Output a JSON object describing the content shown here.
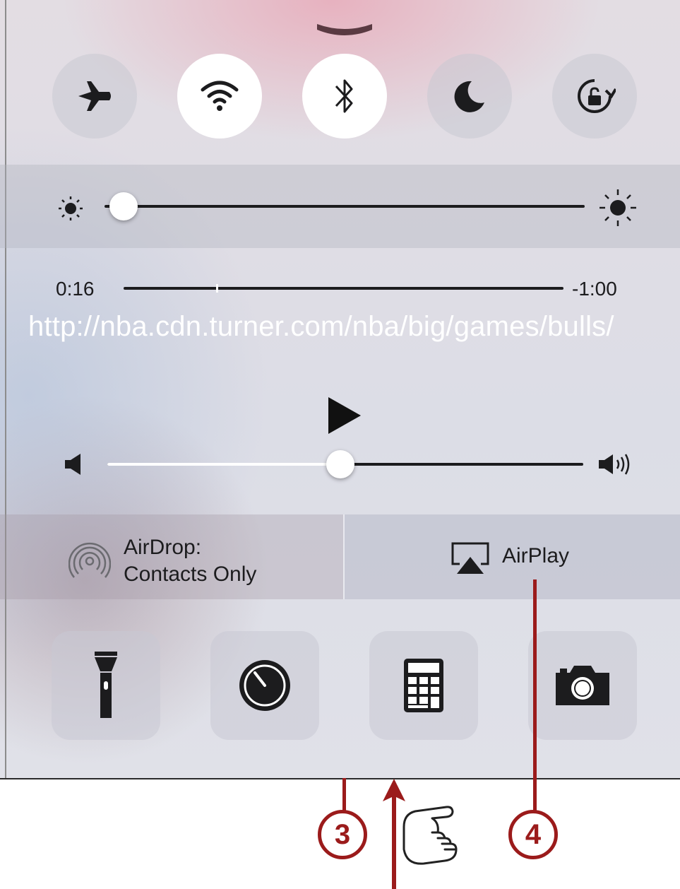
{
  "toggles": [
    {
      "icon": "airplane-icon",
      "state": "off"
    },
    {
      "icon": "wifi-icon",
      "state": "on"
    },
    {
      "icon": "bluetooth-icon",
      "state": "on"
    },
    {
      "icon": "moon-icon",
      "state": "off"
    },
    {
      "icon": "rotation-lock-icon",
      "state": "off"
    }
  ],
  "brightness": {
    "level": 0.04
  },
  "now_playing": {
    "elapsed": "0:16",
    "remaining": "-1:00",
    "progress": 0.21,
    "title": "http://nba.cdn.turner.com/nba/big/games/bulls/"
  },
  "volume": {
    "level": 0.49
  },
  "airdrop": {
    "line1": "AirDrop:",
    "line2": "Contacts Only"
  },
  "airplay": {
    "label": "AirPlay"
  },
  "apps": [
    {
      "icon": "flashlight-icon"
    },
    {
      "icon": "timer-icon"
    },
    {
      "icon": "calculator-icon"
    },
    {
      "icon": "camera-icon"
    }
  ],
  "callouts": {
    "three": "3",
    "four": "4"
  },
  "colors": {
    "accent": "#9b1b1b",
    "toggle_on": "#ffffff"
  }
}
